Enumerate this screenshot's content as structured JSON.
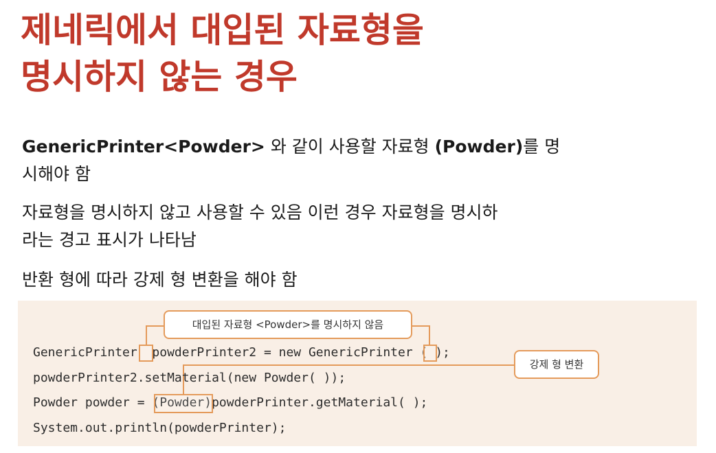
{
  "title": {
    "line1": "제네릭에서 대입된 자료형을",
    "line2": "명시하지 않는 경우"
  },
  "bullets": {
    "b1_strong": "GenericPrinter<Powder>",
    "b1_mid": " 와 같이 사용할 자료형 ",
    "b1_strong2": "(Powder)",
    "b1_end": "를 명",
    "b1_line2": "시해야 함",
    "b2_line1": "자료형을 명시하지 않고 사용할 수 있음 이런 경우 자료형을 명시하",
    "b2_line2": "라는 경고 표시가 나타남",
    "b3_line1": "반환 형에 따라 강제 형 변환을 해야 함"
  },
  "code": {
    "line1_a": "GenericPrinter",
    "line1_b": "  powderPrinter2 = new GenericPrinter",
    "line1_c": " ( );",
    "line2": "powderPrinter2.setMaterial(new Powder( ));",
    "line3_a": "Powder powder = ",
    "line3_b": "(Powder)",
    "line3_c": "powderPrinter.getMaterial( );",
    "line4": "System.out.println(powderPrinter);"
  },
  "callouts": {
    "not_specified": "대입된 자료형 <Powder>를 명시하지 않음",
    "cast": "강제 형 변환"
  },
  "colors": {
    "title": "#c0392b",
    "panel_bg": "#f9efe6",
    "highlight": "#e49a5a"
  }
}
